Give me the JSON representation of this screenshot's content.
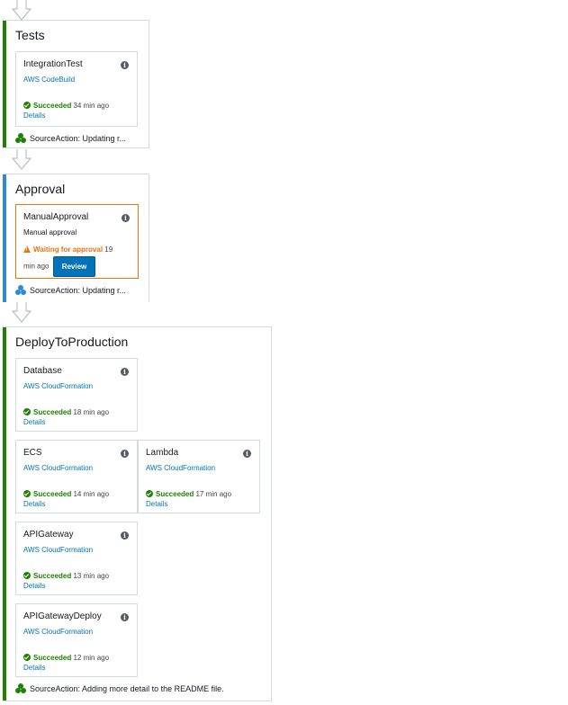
{
  "colors": {
    "succeeded_bar": "#1d8102",
    "in_progress_bar": "#2e8ad8",
    "link": "#0073bb",
    "warning": "#ec7211",
    "success": "#1d8102"
  },
  "stages": {
    "tests": {
      "title": "Tests",
      "actions": [
        {
          "name": "IntegrationTest",
          "provider": "AWS CodeBuild",
          "status": "Succeeded",
          "time": "34 min ago",
          "details": "Details"
        }
      ],
      "source": "SourceAction: Updating r..."
    },
    "approval": {
      "title": "Approval",
      "action": {
        "name": "ManualApproval",
        "provider": "Manual approval",
        "status": "Waiting for approval",
        "time_a": "19",
        "time_b": "min ago",
        "button": "Review"
      },
      "source": "SourceAction: Updating r..."
    },
    "deploy": {
      "title": "DeployToProduction",
      "actions": [
        {
          "name": "Database",
          "provider": "AWS CloudFormation",
          "status": "Succeeded",
          "time": "18 min ago",
          "details": "Details"
        },
        {
          "name": "ECS",
          "provider": "AWS CloudFormation",
          "status": "Succeeded",
          "time": "14 min ago",
          "details": "Details"
        },
        {
          "name": "Lambda",
          "provider": "AWS CloudFormation",
          "status": "Succeeded",
          "time": "17 min ago",
          "details": "Details"
        },
        {
          "name": "APIGateway",
          "provider": "AWS CloudFormation",
          "status": "Succeeded",
          "time": "13 min ago",
          "details": "Details"
        },
        {
          "name": "APIGatewayDeploy",
          "provider": "AWS CloudFormation",
          "status": "Succeeded",
          "time": "12 min ago",
          "details": "Details"
        }
      ],
      "source": "SourceAction: Adding more detail to the README file."
    }
  },
  "icons": {
    "info": "info-icon",
    "check": "check-circle-icon",
    "warning": "warning-icon",
    "source": "source-revision-icon",
    "arrow": "down-arrow-icon"
  },
  "info_glyph": "i"
}
